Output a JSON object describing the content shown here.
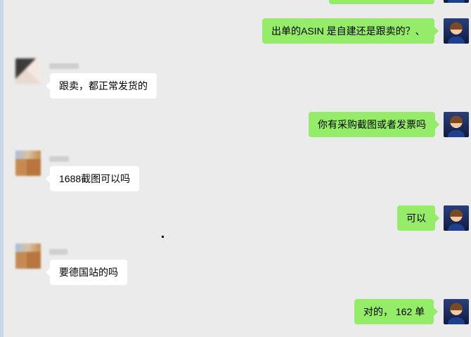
{
  "window": {
    "title": "Chat conversation"
  },
  "colors": {
    "background": "#ebebeb",
    "outgoing_bubble": "#95ec69",
    "incoming_bubble": "#ffffff"
  },
  "messages": [
    {
      "direction": "outgoing",
      "text": "出单的ASIN 是自建还是跟卖的？、"
    },
    {
      "direction": "incoming",
      "text": "跟卖，都正常发货的"
    },
    {
      "direction": "outgoing",
      "text": "你有采购截图或者发票吗"
    },
    {
      "direction": "incoming",
      "text": "1688截图可以吗"
    },
    {
      "direction": "outgoing",
      "text": "可以"
    },
    {
      "direction": "incoming",
      "text": "要德国站的吗"
    },
    {
      "direction": "outgoing",
      "text": "对的， 162 单"
    }
  ]
}
